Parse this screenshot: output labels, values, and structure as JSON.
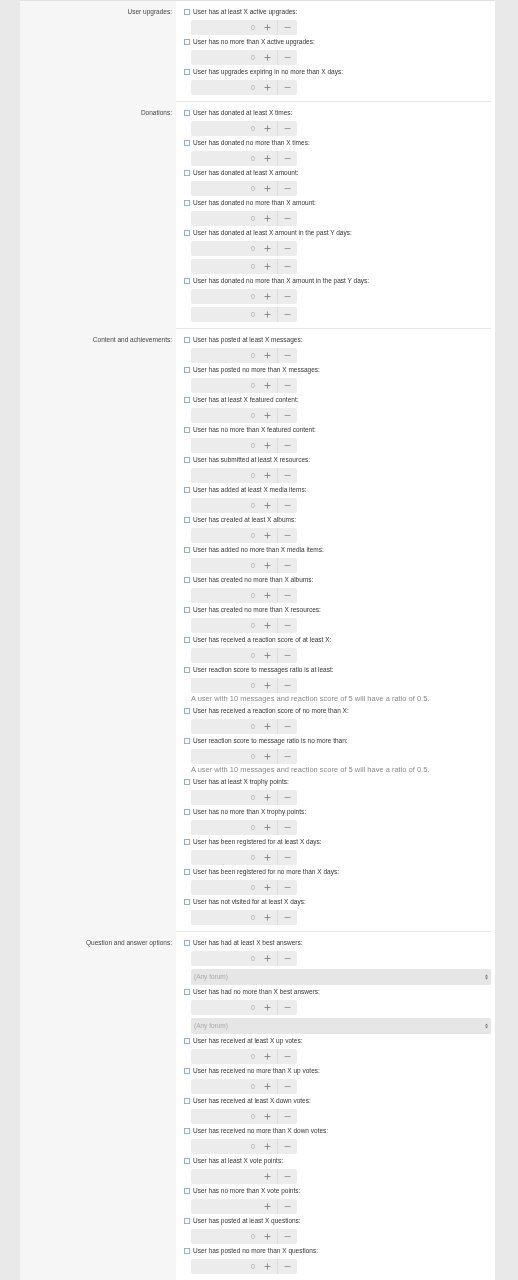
{
  "sections": [
    {
      "label": "User upgrades:",
      "options": [
        {
          "label": "User has at least X active upgrades:",
          "checked": false,
          "fields": [
            {
              "kind": "number",
              "value": "0"
            }
          ]
        },
        {
          "label": "User has no more than X active upgrades:",
          "checked": false,
          "fields": [
            {
              "kind": "number",
              "value": "0"
            }
          ]
        },
        {
          "label": "User has upgrades expiring in no more than X days:",
          "checked": false,
          "fields": [
            {
              "kind": "number",
              "value": "0"
            }
          ]
        }
      ]
    },
    {
      "label": "Donations:",
      "options": [
        {
          "label": "User has donated at least X times:",
          "checked": false,
          "fields": [
            {
              "kind": "number",
              "value": "0"
            }
          ]
        },
        {
          "label": "User has donated no more than X times:",
          "checked": false,
          "fields": [
            {
              "kind": "number",
              "value": "0"
            }
          ]
        },
        {
          "label": "User has donated at least X amount:",
          "checked": false,
          "fields": [
            {
              "kind": "number",
              "value": "0"
            }
          ]
        },
        {
          "label": "User has donated no more than X amount:",
          "checked": false,
          "fields": [
            {
              "kind": "number",
              "value": "0"
            }
          ]
        },
        {
          "label": "User has donated at least X amount in the past Y days:",
          "checked": false,
          "fields": [
            {
              "kind": "number",
              "value": "0"
            },
            {
              "kind": "number",
              "value": "0"
            }
          ]
        },
        {
          "label": "User has donated no more than X amount in the past Y days:",
          "checked": false,
          "fields": [
            {
              "kind": "number",
              "value": "0"
            },
            {
              "kind": "number",
              "value": "0"
            }
          ]
        }
      ]
    },
    {
      "label": "Content and achievements:",
      "options": [
        {
          "label": "User has posted at least X messages:",
          "checked": false,
          "fields": [
            {
              "kind": "number",
              "value": "0"
            }
          ]
        },
        {
          "label": "User has posted no more than X messages:",
          "checked": false,
          "fields": [
            {
              "kind": "number",
              "value": "0"
            }
          ]
        },
        {
          "label": "User has at least X featured content:",
          "checked": false,
          "fields": [
            {
              "kind": "number",
              "value": "0"
            }
          ]
        },
        {
          "label": "User has no more than X featured content:",
          "checked": false,
          "fields": [
            {
              "kind": "number",
              "value": "0"
            }
          ]
        },
        {
          "label": "User has submitted at least X resources:",
          "checked": false,
          "fields": [
            {
              "kind": "number",
              "value": "0"
            }
          ]
        },
        {
          "label": "User has added at least X media items:",
          "checked": false,
          "fields": [
            {
              "kind": "number",
              "value": "0"
            }
          ]
        },
        {
          "label": "User has created at least X albums:",
          "checked": false,
          "fields": [
            {
              "kind": "number",
              "value": "0"
            }
          ]
        },
        {
          "label": "User has added no more than X media items:",
          "checked": false,
          "fields": [
            {
              "kind": "number",
              "value": "0"
            }
          ]
        },
        {
          "label": "User has created no more than X albums:",
          "checked": false,
          "fields": [
            {
              "kind": "number",
              "value": "0"
            }
          ]
        },
        {
          "label": "User has created no more than X resources:",
          "checked": false,
          "fields": [
            {
              "kind": "number",
              "value": "0"
            }
          ]
        },
        {
          "label": "User has received a reaction score of at least X:",
          "checked": false,
          "fields": [
            {
              "kind": "number",
              "value": "0"
            }
          ]
        },
        {
          "label": "User reaction score to messages ratio is at least:",
          "checked": false,
          "fields": [
            {
              "kind": "number",
              "value": "0"
            }
          ],
          "hint": "A user with 10 messages and reaction score of 5 will have a ratio of 0.5."
        },
        {
          "label": "User has received a reaction score of no more than X:",
          "checked": false,
          "fields": [
            {
              "kind": "number",
              "value": "0"
            }
          ]
        },
        {
          "label": "User reaction score to message ratio is no more than:",
          "checked": false,
          "fields": [
            {
              "kind": "number",
              "value": "0"
            }
          ],
          "hint": "A user with 10 messages and reaction score of 5 will have a ratio of 0.5."
        },
        {
          "label": "User has at least X trophy points:",
          "checked": false,
          "fields": [
            {
              "kind": "number",
              "value": "0"
            }
          ]
        },
        {
          "label": "User has no more than X trophy points:",
          "checked": false,
          "fields": [
            {
              "kind": "number",
              "value": "0"
            }
          ]
        },
        {
          "label": "User has been registered for at least X days:",
          "checked": false,
          "fields": [
            {
              "kind": "number",
              "value": "0"
            }
          ]
        },
        {
          "label": "User has been registered for no more than X days:",
          "checked": false,
          "fields": [
            {
              "kind": "number",
              "value": "0"
            }
          ]
        },
        {
          "label": "User has not visited for at least X days:",
          "checked": false,
          "fields": [
            {
              "kind": "number",
              "value": "0"
            }
          ]
        }
      ]
    },
    {
      "label": "Question and answer options:",
      "options": [
        {
          "label": "User has had at least X best answers:",
          "checked": false,
          "fields": [
            {
              "kind": "number",
              "value": "0"
            },
            {
              "kind": "select",
              "value": "(Any forum)"
            }
          ]
        },
        {
          "label": "User has had no more than X best answers:",
          "checked": false,
          "fields": [
            {
              "kind": "number",
              "value": "0"
            },
            {
              "kind": "select",
              "value": "(Any forum)"
            }
          ]
        },
        {
          "label": "User has received at least X up votes:",
          "checked": false,
          "fields": [
            {
              "kind": "number",
              "value": "0"
            }
          ]
        },
        {
          "label": "User has received no more than X up votes:",
          "checked": false,
          "fields": [
            {
              "kind": "number",
              "value": "0"
            }
          ]
        },
        {
          "label": "User has received at least X down votes:",
          "checked": false,
          "fields": [
            {
              "kind": "number",
              "value": "0"
            }
          ]
        },
        {
          "label": "User has received no more than X down votes:",
          "checked": false,
          "fields": [
            {
              "kind": "number",
              "value": "0"
            }
          ]
        },
        {
          "label": "User has at least X vote points:",
          "checked": false,
          "fields": [
            {
              "kind": "number"
            }
          ]
        },
        {
          "label": "User has no more than X vote points:",
          "checked": false,
          "fields": [
            {
              "kind": "number"
            }
          ]
        },
        {
          "label": "User has posted at least X questions:",
          "checked": false,
          "fields": [
            {
              "kind": "number",
              "value": "0"
            }
          ]
        },
        {
          "label": "User has posted no more than X questions:",
          "checked": false,
          "fields": [
            {
              "kind": "number",
              "value": "0"
            }
          ]
        }
      ]
    }
  ]
}
